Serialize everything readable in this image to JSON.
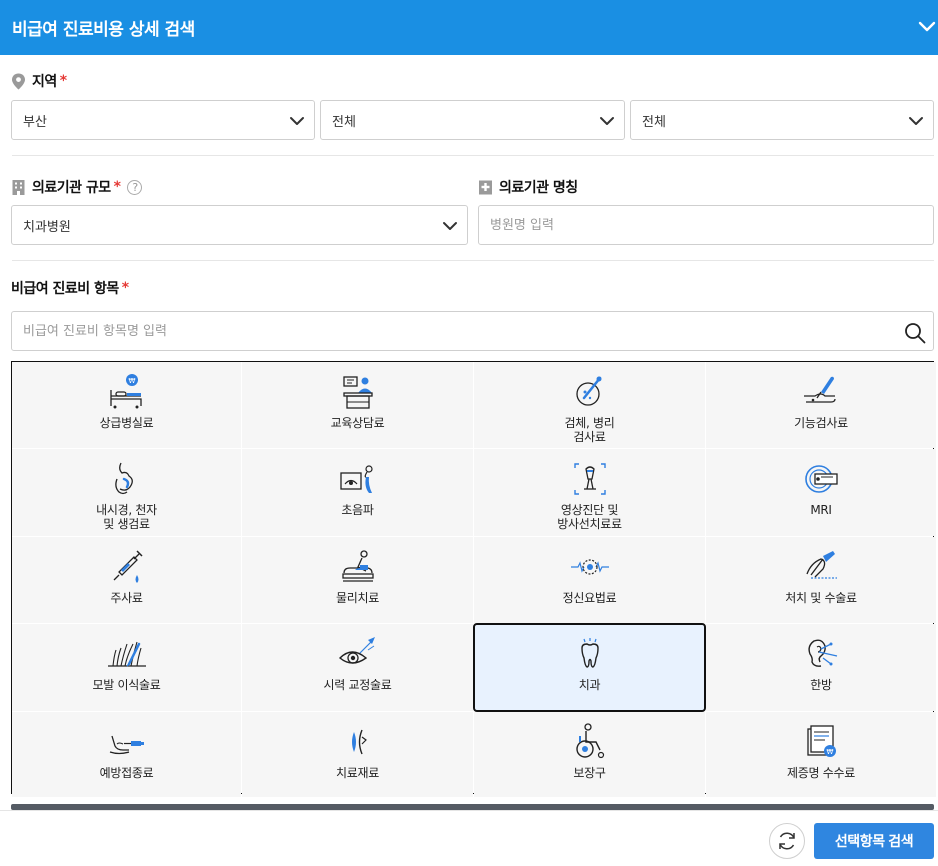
{
  "header": {
    "title": "비급여 진료비용 상세 검색"
  },
  "region": {
    "label": "지역",
    "required_mark": "*",
    "selects": [
      "부산",
      "전체",
      "전체"
    ]
  },
  "institution": {
    "scale_label": "의료기관 규모",
    "required_mark": "*",
    "help": "?",
    "scale_value": "치과병원",
    "name_label": "의료기관 명칭",
    "name_placeholder": "병원명 입력"
  },
  "items": {
    "label": "비급여 진료비 항목",
    "required_mark": "*",
    "search_placeholder": "비급여 진료비 항목명 입력",
    "categories": [
      {
        "label": "상급병실료",
        "icon": "hospital-bed-icon"
      },
      {
        "label": "교육상담료",
        "icon": "counseling-desk-icon"
      },
      {
        "label": "검체, 병리\n검사료",
        "icon": "specimen-test-icon"
      },
      {
        "label": "기능검사료",
        "icon": "function-test-icon"
      },
      {
        "label": "내시경, 천자\n및 생검료",
        "icon": "endoscope-icon"
      },
      {
        "label": "초음파",
        "icon": "ultrasound-icon"
      },
      {
        "label": "영상진단 및\n방사선치료료",
        "icon": "xray-icon"
      },
      {
        "label": "MRI",
        "icon": "mri-icon"
      },
      {
        "label": "주사료",
        "icon": "syringe-icon"
      },
      {
        "label": "물리치료",
        "icon": "physical-therapy-icon"
      },
      {
        "label": "정신요법료",
        "icon": "brain-wave-icon"
      },
      {
        "label": "처치 및 수술료",
        "icon": "scalpel-icon"
      },
      {
        "label": "모발 이식술료",
        "icon": "hair-transplant-icon"
      },
      {
        "label": "시력 교정술료",
        "icon": "eye-laser-icon"
      },
      {
        "label": "치과",
        "icon": "tooth-icon"
      },
      {
        "label": "한방",
        "icon": "acupuncture-ear-icon"
      },
      {
        "label": "예방접종료",
        "icon": "vaccination-icon"
      },
      {
        "label": "치료재료",
        "icon": "lens-material-icon"
      },
      {
        "label": "보장구",
        "icon": "wheelchair-icon"
      },
      {
        "label": "제증명 수수료",
        "icon": "certificate-icon"
      }
    ],
    "selected": "치과"
  },
  "footer": {
    "submit_label": "선택항목 검색",
    "reset_icon": "refresh-icon"
  },
  "colors": {
    "header": "#1a8fe3",
    "accent": "#2f86e0",
    "required": "#e53935",
    "selected_bg": "#e8f2fe",
    "icon_blue": "#2f7fe0"
  }
}
